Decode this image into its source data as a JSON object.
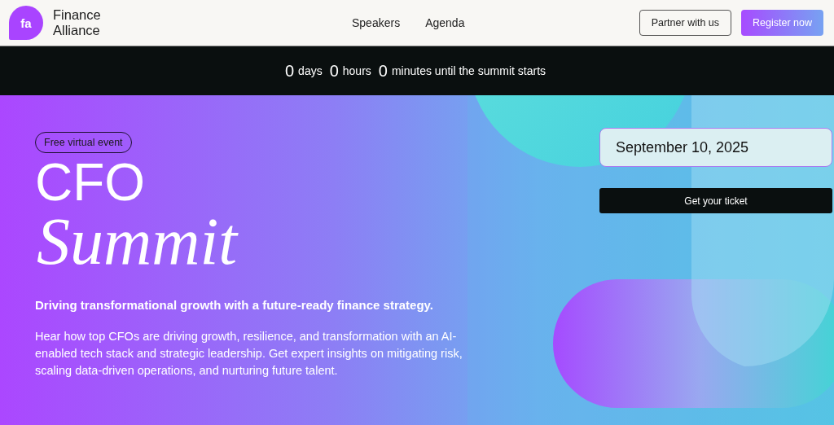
{
  "brand": {
    "logo": "fa",
    "name_lines": [
      "Finance",
      "Alliance"
    ]
  },
  "nav": [
    "Speakers",
    "Agenda"
  ],
  "header_buttons": [
    {
      "label": "Partner with us",
      "kind": "outline"
    },
    {
      "label": "Register now",
      "kind": "gradient"
    }
  ],
  "countdown": [
    {
      "value": "0",
      "unit": "days"
    },
    {
      "value": "0",
      "unit": "hours"
    },
    {
      "value": "0",
      "unit": "minutes until the summit starts"
    }
  ],
  "hero": {
    "badge": "Free virtual event",
    "title_lines": [
      "CFO",
      "Summit"
    ],
    "tagline": "Driving transformational growth with a future-ready finance strategy.",
    "description": "Hear how top CFOs are driving growth, resilience, and transformation with an AI-enabled tech stack and strategic leadership. Get expert insights on mitigating risk, scaling data-driven operations, and nurturing future talent.",
    "kind": "picture"
  },
  "event": {
    "date": "September 10, 2025",
    "cta": "Get your ticket"
  }
}
